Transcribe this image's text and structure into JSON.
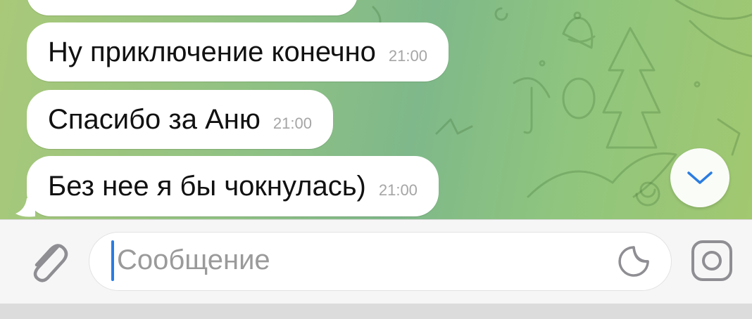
{
  "messages": [
    {
      "text": "Ну приключение конечно",
      "time": "21:00"
    },
    {
      "text": "Спасибо за Аню",
      "time": "21:00"
    },
    {
      "text": "Без нее я бы чокнулась)",
      "time": "21:00"
    }
  ],
  "input": {
    "placeholder": "Сообщение"
  },
  "colors": {
    "accent": "#2a7de1",
    "bubble": "#ffffff",
    "wallpaper": "#8fc184",
    "icon": "#8e8e93"
  },
  "icons": [
    "paperclip-icon",
    "sticker-icon",
    "camera-icon",
    "chevron-down-icon"
  ]
}
